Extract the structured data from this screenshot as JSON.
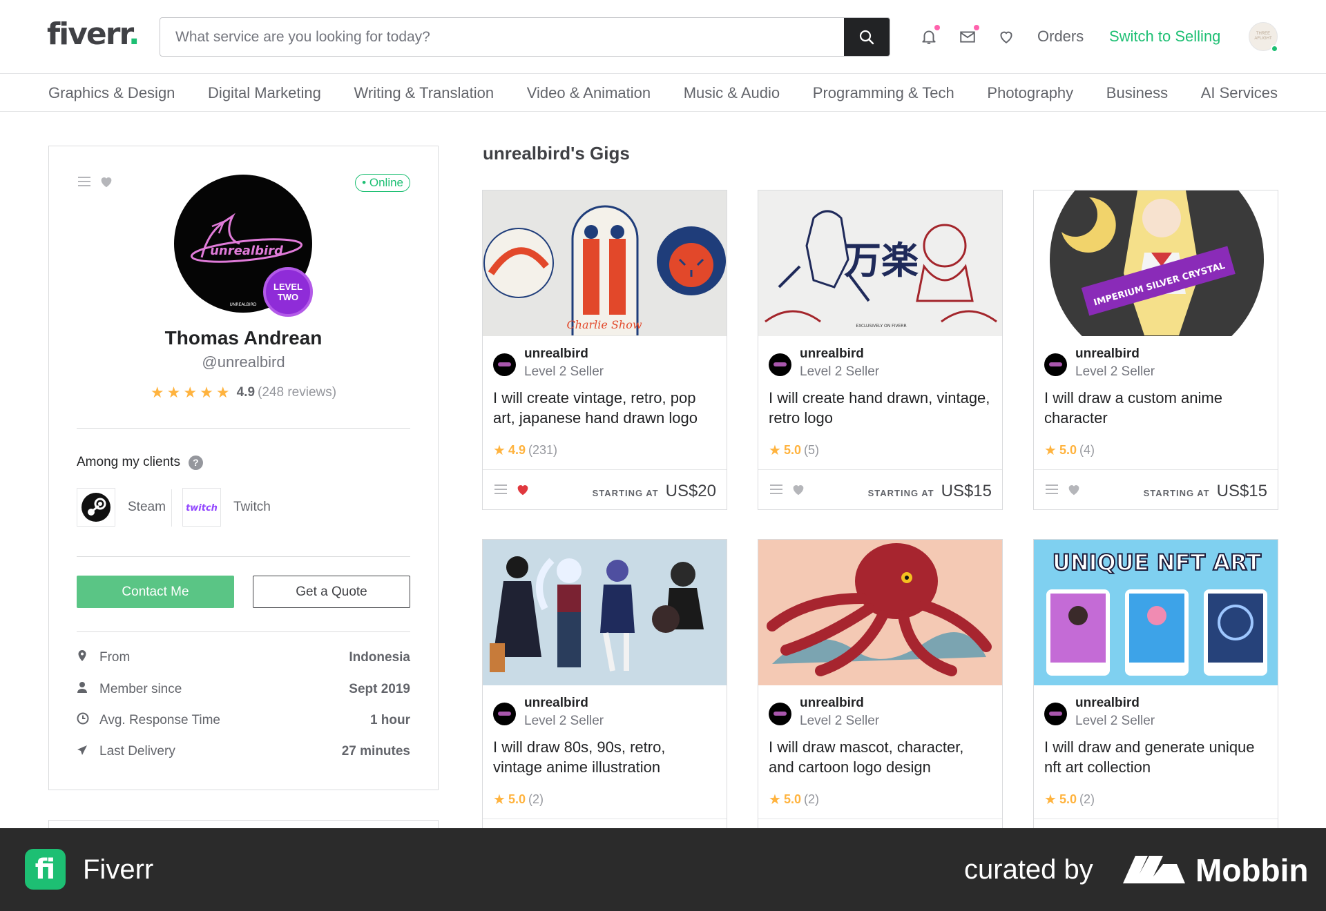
{
  "header": {
    "logo_text": "fiverr",
    "logo_dot": ".",
    "search_placeholder": "What service are you looking for today?",
    "orders_label": "Orders",
    "switch_label": "Switch to Selling",
    "avatar_text": "THREE AFLIGHT"
  },
  "categories": [
    "Graphics & Design",
    "Digital Marketing",
    "Writing & Translation",
    "Video & Animation",
    "Music & Audio",
    "Programming & Tech",
    "Photography",
    "Business",
    "AI Services"
  ],
  "profile": {
    "online_label": "Online",
    "level_badge": "LEVEL TWO",
    "name": "Thomas Andrean",
    "handle": "@unrealbird",
    "rating": "4.9",
    "reviews": "(248 reviews)",
    "stars": 5,
    "clients_title": "Among my clients",
    "clients": [
      {
        "name": "Steam",
        "icon": "steam-logo"
      },
      {
        "name": "Twitch",
        "icon": "twitch-logo"
      }
    ],
    "contact_label": "Contact Me",
    "quote_label": "Get a Quote",
    "info": [
      {
        "label": "From",
        "value": "Indonesia",
        "icon": "location-pin-icon"
      },
      {
        "label": "Member since",
        "value": "Sept 2019",
        "icon": "user-icon"
      },
      {
        "label": "Avg. Response Time",
        "value": "1 hour",
        "icon": "clock-icon"
      },
      {
        "label": "Last Delivery",
        "value": "27 minutes",
        "icon": "paper-plane-icon"
      }
    ]
  },
  "gigs_title": "unrealbird's Gigs",
  "gigs": [
    {
      "seller": "unrealbird",
      "level": "Level 2 Seller",
      "title": "I will create vintage, retro, pop art, japanese hand drawn logo",
      "rating": "4.9",
      "count": "(231)",
      "price_label": "STARTING AT",
      "price": "US$20",
      "favorited": true
    },
    {
      "seller": "unrealbird",
      "level": "Level 2 Seller",
      "title": "I will create hand drawn, vintage, retro logo",
      "rating": "5.0",
      "count": "(5)",
      "price_label": "STARTING AT",
      "price": "US$15",
      "favorited": false
    },
    {
      "seller": "unrealbird",
      "level": "Level 2 Seller",
      "title": "I will draw a custom anime character",
      "rating": "5.0",
      "count": "(4)",
      "price_label": "STARTING AT",
      "price": "US$15",
      "favorited": false
    },
    {
      "seller": "unrealbird",
      "level": "Level 2 Seller",
      "title": "I will draw 80s, 90s, retro, vintage anime illustration",
      "rating": "5.0",
      "count": "(2)"
    },
    {
      "seller": "unrealbird",
      "level": "Level 2 Seller",
      "title": "I will draw mascot, character, and cartoon logo design",
      "rating": "5.0",
      "count": "(2)"
    },
    {
      "seller": "unrealbird",
      "level": "Level 2 Seller",
      "title": "I will draw and generate unique nft art collection",
      "rating": "5.0",
      "count": "(2)"
    }
  ],
  "gig_images": {
    "g1_text": "Charlie Show",
    "g2_text": "万楽",
    "g2_caption": "EXCLUSIVELY ON FIVERR",
    "g3_text": "IMPERIUM SILVER CRYSTAL",
    "g6_text": "UNIQUE NFT ART"
  },
  "footer": {
    "app_name": "Fiverr",
    "curated_by": "curated by",
    "brand": "Mobbin"
  },
  "colors": {
    "brand_green": "#1dbf73",
    "contact_button": "#5ac585",
    "star": "#ffb33e",
    "level_purple": "#8f2cd8",
    "fav_red": "#e0383e"
  }
}
